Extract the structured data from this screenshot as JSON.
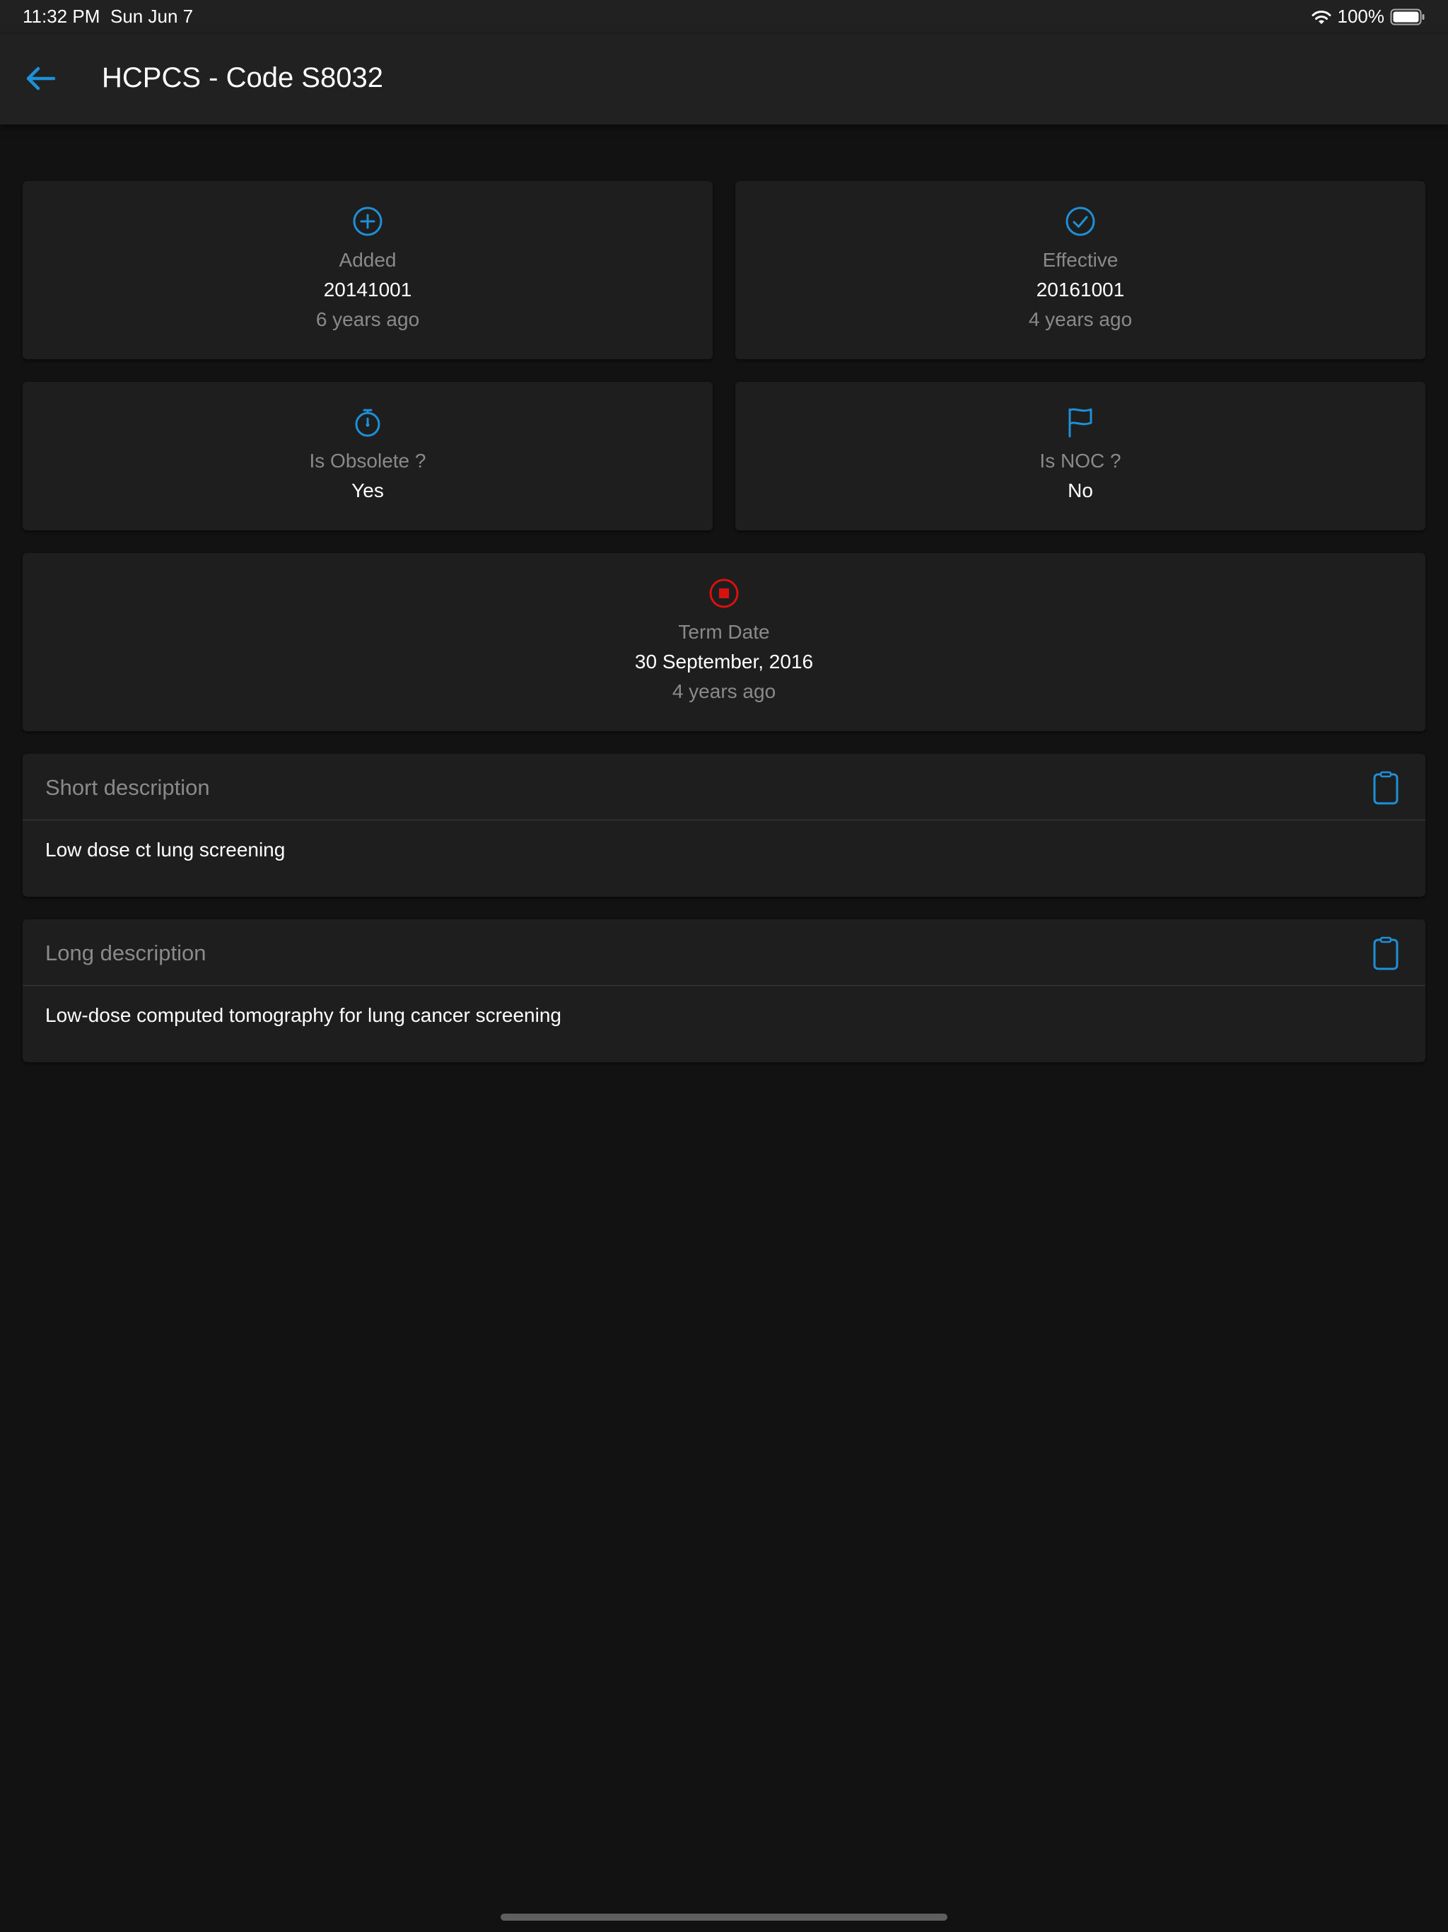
{
  "status_bar": {
    "time": "11:32 PM",
    "date": "Sun Jun 7",
    "battery": "100%"
  },
  "header": {
    "title": "HCPCS - Code S8032"
  },
  "colors": {
    "accent": "#1e90d8",
    "danger": "#d81010",
    "background": "#121212",
    "card": "#1e1e1e"
  },
  "cards": {
    "added": {
      "icon": "plus-circle-icon",
      "label": "Added",
      "value": "20141001",
      "sub": "6 years ago"
    },
    "effective": {
      "icon": "check-circle-icon",
      "label": "Effective",
      "value": "20161001",
      "sub": "4 years ago"
    },
    "obsolete": {
      "icon": "stopwatch-icon",
      "label": "Is Obsolete ?",
      "value": "Yes"
    },
    "noc": {
      "icon": "flag-icon",
      "label": "Is NOC ?",
      "value": "No"
    },
    "term": {
      "icon": "stop-circle-icon",
      "label": "Term Date",
      "value": "30 September, 2016",
      "sub": "4 years ago"
    }
  },
  "short_description": {
    "title": "Short description",
    "text": "Low dose ct lung screening",
    "icon": "clipboard-icon"
  },
  "long_description": {
    "title": "Long description",
    "text": "Low-dose computed tomography for lung cancer screening",
    "icon": "clipboard-icon"
  }
}
